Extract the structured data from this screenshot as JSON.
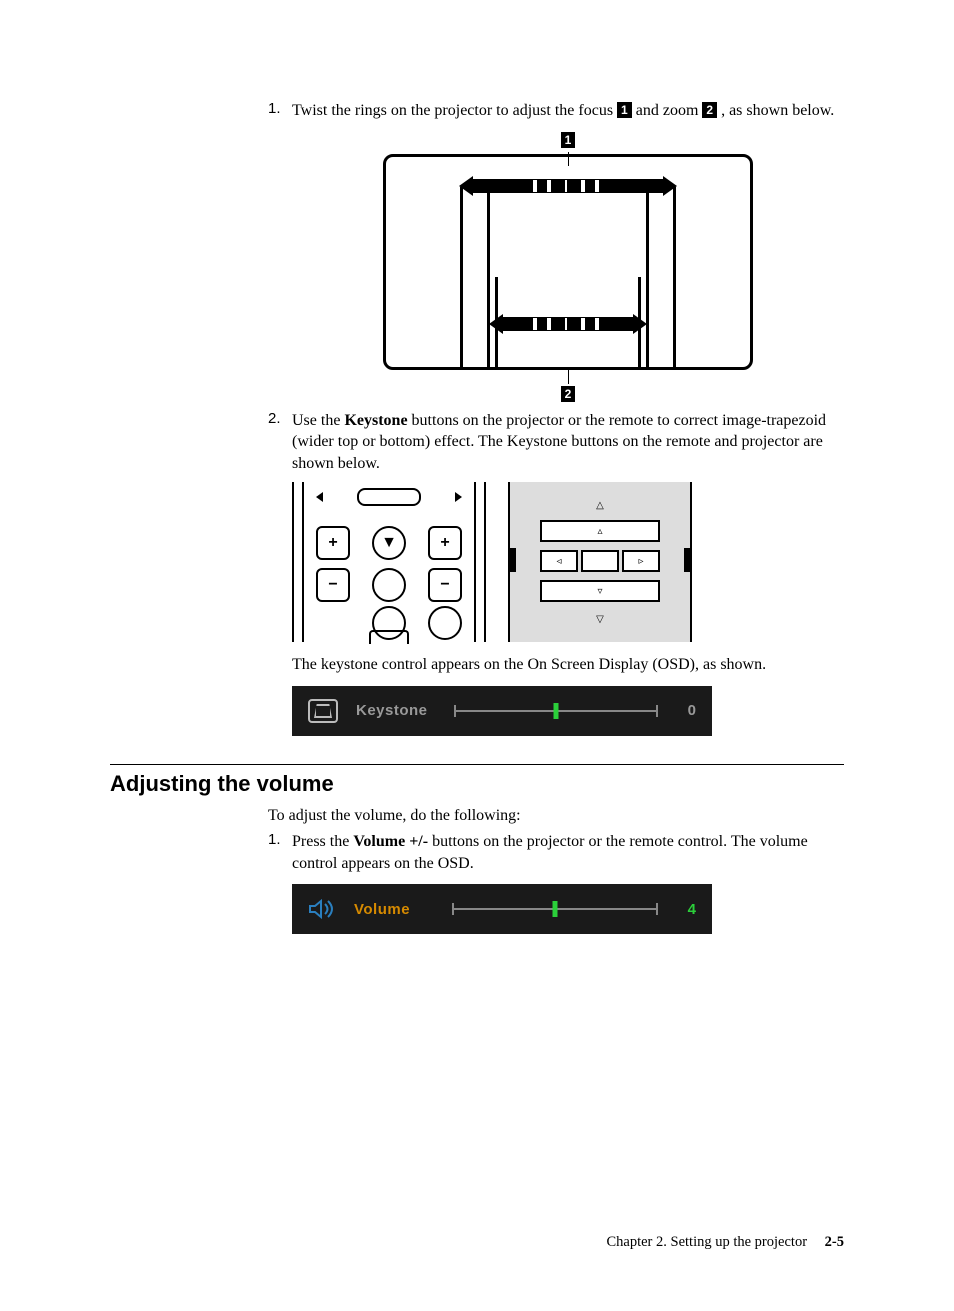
{
  "step1": {
    "num": "1.",
    "text_a": "Twist the rings on the projector to adjust the focus ",
    "callout1": "1",
    "text_b": " and zoom ",
    "callout2": "2",
    "text_c": " , as shown below."
  },
  "fig1": {
    "top_callout": "1",
    "bottom_callout": "2"
  },
  "step2": {
    "num": "2.",
    "text_a": "Use the ",
    "bold_a": "Keystone",
    "text_b": " buttons on the projector or the remote to correct image-trapezoid (wider top or bottom) effect. The Keystone buttons on the remote and projector are shown below."
  },
  "remote_btns": {
    "plus": "+",
    "minus": "−",
    "down": "▼"
  },
  "panel_sym": {
    "up_out": "△",
    "up": "▵",
    "left": "◃",
    "right": "▹",
    "down": "▿",
    "down_out": "▽"
  },
  "osd_caption": "The keystone control appears on the On Screen Display (OSD), as shown.",
  "osd_keystone": {
    "label": "Keystone",
    "value": "0"
  },
  "section_heading": "Adjusting the volume",
  "vol_intro": "To adjust the volume, do the following:",
  "vol_step1": {
    "num": "1.",
    "text_a": "Press the ",
    "bold_a": "Volume +/-",
    "text_b": " buttons on the projector or the remote control. The volume control appears on the OSD."
  },
  "osd_volume": {
    "label": "Volume",
    "value": "4",
    "icon": "◀꜀"
  },
  "footer": {
    "chapter": "Chapter 2. Setting up the projector",
    "page": "2-5"
  }
}
